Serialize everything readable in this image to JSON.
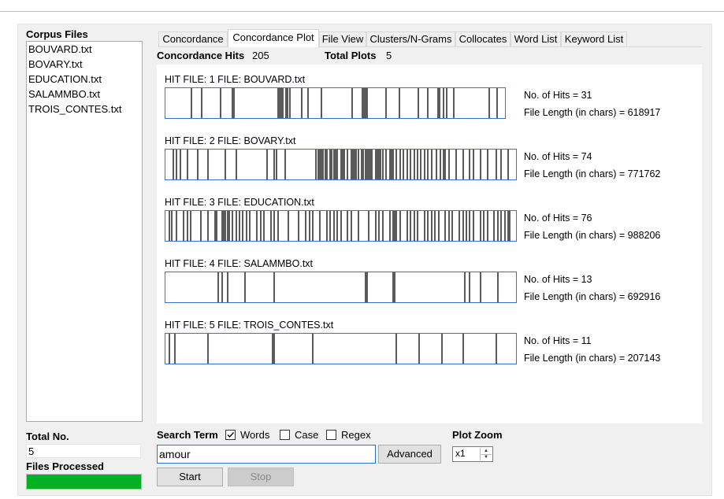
{
  "corpus": {
    "label": "Corpus Files",
    "files": [
      "BOUVARD.txt",
      "BOVARY.txt",
      "EDUCATION.txt",
      "SALAMMBO.txt",
      "TROIS_CONTES.txt"
    ],
    "total_label": "Total No.",
    "total_value": "5",
    "processed_label": "Files Processed",
    "processed_fraction": 1.0,
    "progress_color": "#06b025"
  },
  "tabs": [
    {
      "label": "Concordance",
      "active": false
    },
    {
      "label": "Concordance Plot",
      "active": true
    },
    {
      "label": "File View",
      "active": false
    },
    {
      "label": "Clusters/N-Grams",
      "active": false
    },
    {
      "label": "Collocates",
      "active": false
    },
    {
      "label": "Word List",
      "active": false
    },
    {
      "label": "Keyword List",
      "active": false
    }
  ],
  "summary": {
    "hits_label": "Concordance Hits",
    "hits_value": "205",
    "plots_label": "Total Plots",
    "plots_value": "5"
  },
  "plots": [
    {
      "title": "HIT FILE: 1   FILE: BOUVARD.txt",
      "hits_text": "No. of Hits = 31",
      "length_text": "File Length (in chars) = 618917",
      "hit_positions": [
        0.075,
        0.104,
        0.162,
        0.195,
        0.2,
        0.33,
        0.335,
        0.34,
        0.345,
        0.355,
        0.36,
        0.365,
        0.4,
        0.42,
        0.46,
        0.55,
        0.58,
        0.585,
        0.59,
        0.595,
        0.65,
        0.69,
        0.745,
        0.775,
        0.805,
        0.81,
        0.82,
        0.83,
        0.85,
        0.955,
        0.98
      ]
    },
    {
      "title": "HIT FILE: 2   FILE: BOVARY.txt",
      "hits_text": "No. of Hits = 74",
      "length_text": "File Length (in chars) = 771762",
      "hit_positions": [
        0.02,
        0.03,
        0.04,
        0.06,
        0.09,
        0.12,
        0.17,
        0.2,
        0.29,
        0.31,
        0.315,
        0.34,
        0.43,
        0.435,
        0.46,
        0.44,
        0.445,
        0.45,
        0.455,
        0.47,
        0.475,
        0.48,
        0.485,
        0.49,
        0.5,
        0.505,
        0.51,
        0.52,
        0.53,
        0.535,
        0.54,
        0.545,
        0.55,
        0.56,
        0.565,
        0.57,
        0.575,
        0.58,
        0.585,
        0.59,
        0.6,
        0.605,
        0.61,
        0.615,
        0.62,
        0.63,
        0.64,
        0.645,
        0.65,
        0.66,
        0.67,
        0.68,
        0.69,
        0.7,
        0.71,
        0.72,
        0.73,
        0.74,
        0.75,
        0.76,
        0.775,
        0.785,
        0.795,
        0.8,
        0.81,
        0.83,
        0.85,
        0.87,
        0.88,
        0.9,
        0.92,
        0.945,
        0.96,
        0.98
      ]
    },
    {
      "title": "HIT FILE: 3   FILE: EDUCATION.txt",
      "hits_text": "No. of Hits = 76",
      "length_text": "File Length (in chars) = 988206",
      "hit_positions": [
        0.01,
        0.015,
        0.03,
        0.05,
        0.06,
        0.07,
        0.1,
        0.12,
        0.14,
        0.145,
        0.16,
        0.165,
        0.17,
        0.175,
        0.18,
        0.19,
        0.2,
        0.21,
        0.22,
        0.23,
        0.24,
        0.26,
        0.27,
        0.28,
        0.3,
        0.31,
        0.32,
        0.35,
        0.38,
        0.4,
        0.41,
        0.42,
        0.44,
        0.46,
        0.47,
        0.48,
        0.49,
        0.5,
        0.52,
        0.53,
        0.55,
        0.58,
        0.6,
        0.61,
        0.62,
        0.64,
        0.65,
        0.655,
        0.66,
        0.67,
        0.69,
        0.7,
        0.71,
        0.72,
        0.74,
        0.75,
        0.76,
        0.77,
        0.78,
        0.8,
        0.81,
        0.82,
        0.84,
        0.85,
        0.86,
        0.87,
        0.88,
        0.9,
        0.91,
        0.92,
        0.94,
        0.95,
        0.96,
        0.97,
        0.98,
        0.985
      ]
    },
    {
      "title": "HIT FILE: 4   FILE: SALAMMBO.txt",
      "hits_text": "No. of Hits = 13",
      "length_text": "File Length (in chars) = 692916",
      "hit_positions": [
        0.15,
        0.16,
        0.175,
        0.225,
        0.31,
        0.57,
        0.575,
        0.65,
        0.655,
        0.855,
        0.87,
        0.9,
        0.95
      ]
    },
    {
      "title": "HIT FILE: 5   FILE: TROIS_CONTES.txt",
      "hits_text": "No. of Hits = 11",
      "length_text": "File Length (in chars) = 207143",
      "hit_positions": [
        0.01,
        0.025,
        0.12,
        0.305,
        0.31,
        0.42,
        0.66,
        0.725,
        0.79,
        0.85,
        0.945
      ]
    }
  ],
  "search": {
    "label": "Search Term",
    "words_label": "Words",
    "words_checked": true,
    "case_label": "Case",
    "case_checked": false,
    "regex_label": "Regex",
    "regex_checked": false,
    "value": "amour",
    "advanced_label": "Advanced",
    "start_label": "Start",
    "stop_label": "Stop"
  },
  "zoom": {
    "label": "Plot Zoom",
    "value": "x1"
  },
  "colors": {
    "plot_border": "#3c6fd6",
    "hit_line": "#000000"
  }
}
